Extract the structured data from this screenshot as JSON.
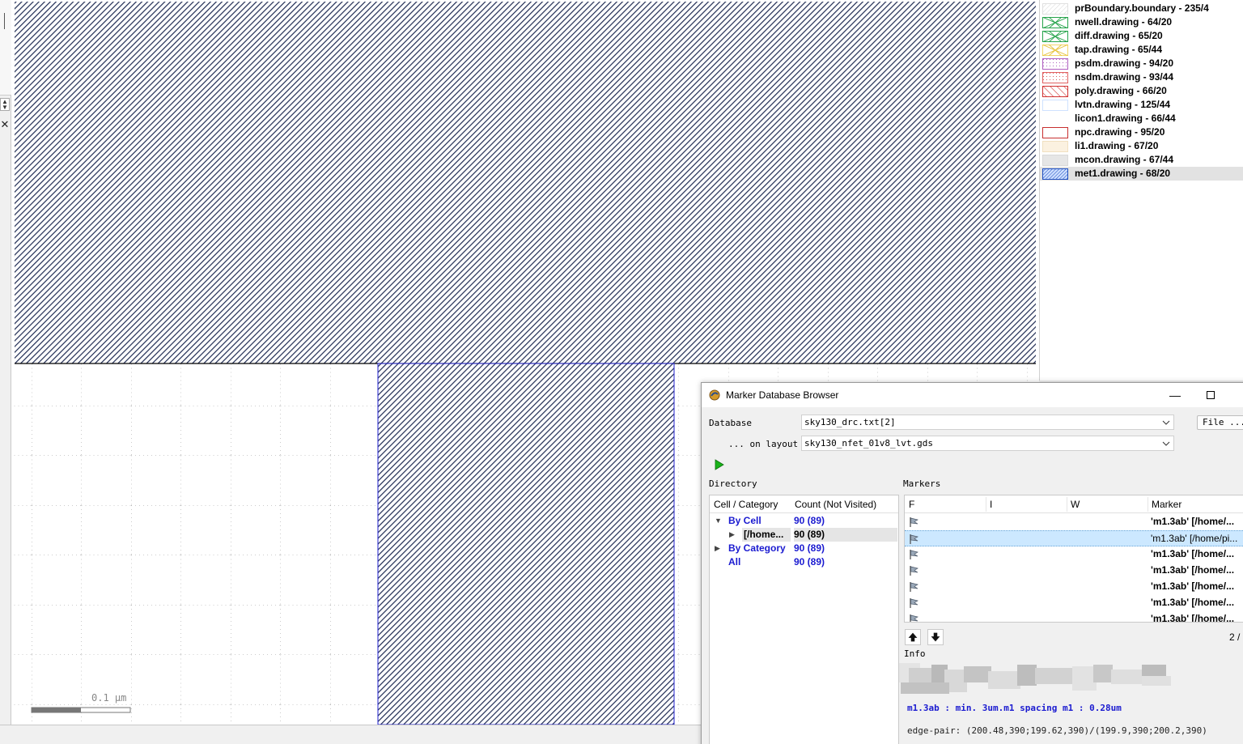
{
  "layers": [
    {
      "name": "prBoundary.boundary - 235/4",
      "swatch": "hatch-light"
    },
    {
      "name": "nwell.drawing - 64/20",
      "swatch": "cross-green"
    },
    {
      "name": "diff.drawing - 65/20",
      "swatch": "cross-green"
    },
    {
      "name": "tap.drawing - 65/44",
      "swatch": "cross-yellow"
    },
    {
      "name": "psdm.drawing - 94/20",
      "swatch": "dots-purple"
    },
    {
      "name": "nsdm.drawing - 93/44",
      "swatch": "dots-red"
    },
    {
      "name": "poly.drawing - 66/20",
      "swatch": "hatch-red"
    },
    {
      "name": "lvtn.drawing - 125/44",
      "swatch": "outline-blue"
    },
    {
      "name": "licon1.drawing - 66/44",
      "swatch": "none"
    },
    {
      "name": "npc.drawing - 95/20",
      "swatch": "outline-red"
    },
    {
      "name": "li1.drawing - 67/20",
      "swatch": "fill-cream"
    },
    {
      "name": "mcon.drawing - 67/44",
      "swatch": "fill-light"
    },
    {
      "name": "met1.drawing - 68/20",
      "swatch": "hatch-blue",
      "selected": true
    }
  ],
  "canvas": {
    "scale_label": "0.1 µm"
  },
  "mdb": {
    "title": "Marker Database Browser",
    "database_label": "Database",
    "database_value": "sky130_drc.txt[2]",
    "layout_label": "... on layout",
    "layout_value": "sky130_nfet_01v8_lvt.gds",
    "file_button": "File ...",
    "directory_label": "Directory",
    "markers_label": "Markers",
    "dir_columns": [
      "Cell / Category",
      "Count (Not Visited)"
    ],
    "dir_rows": [
      {
        "name": "By Cell",
        "count": "90 (89)",
        "expander": "▼",
        "blue": true
      },
      {
        "name": "[/home...",
        "count": "90 (89)",
        "expander": "▶",
        "blue": false,
        "selected": true
      },
      {
        "name": "By Category",
        "count": "90 (89)",
        "expander": "▶",
        "blue": true
      },
      {
        "name": "All",
        "count": "90 (89)",
        "expander": "",
        "blue": true
      }
    ],
    "marker_columns": [
      "F",
      "I",
      "W",
      "Marker"
    ],
    "markers": [
      {
        "text": "'m1.3ab' [/home/...",
        "bold": true
      },
      {
        "text": "'m1.3ab' [/home/pi...",
        "bold": false,
        "selected": true
      },
      {
        "text": "'m1.3ab' [/home/...",
        "bold": true
      },
      {
        "text": "'m1.3ab' [/home/...",
        "bold": true
      },
      {
        "text": "'m1.3ab' [/home/...",
        "bold": true
      },
      {
        "text": "'m1.3ab' [/home/...",
        "bold": true
      },
      {
        "text": "'m1.3ab' [/home/...",
        "bold": true
      }
    ],
    "nav_count": "2 /",
    "info_label": "Info",
    "info_rule": "m1.3ab : min. 3um.m1 spacing m1 : 0.28um",
    "info_edge": "edge-pair: (200.48,390;199.62,390)/(199.9,390;200.2,390)"
  }
}
